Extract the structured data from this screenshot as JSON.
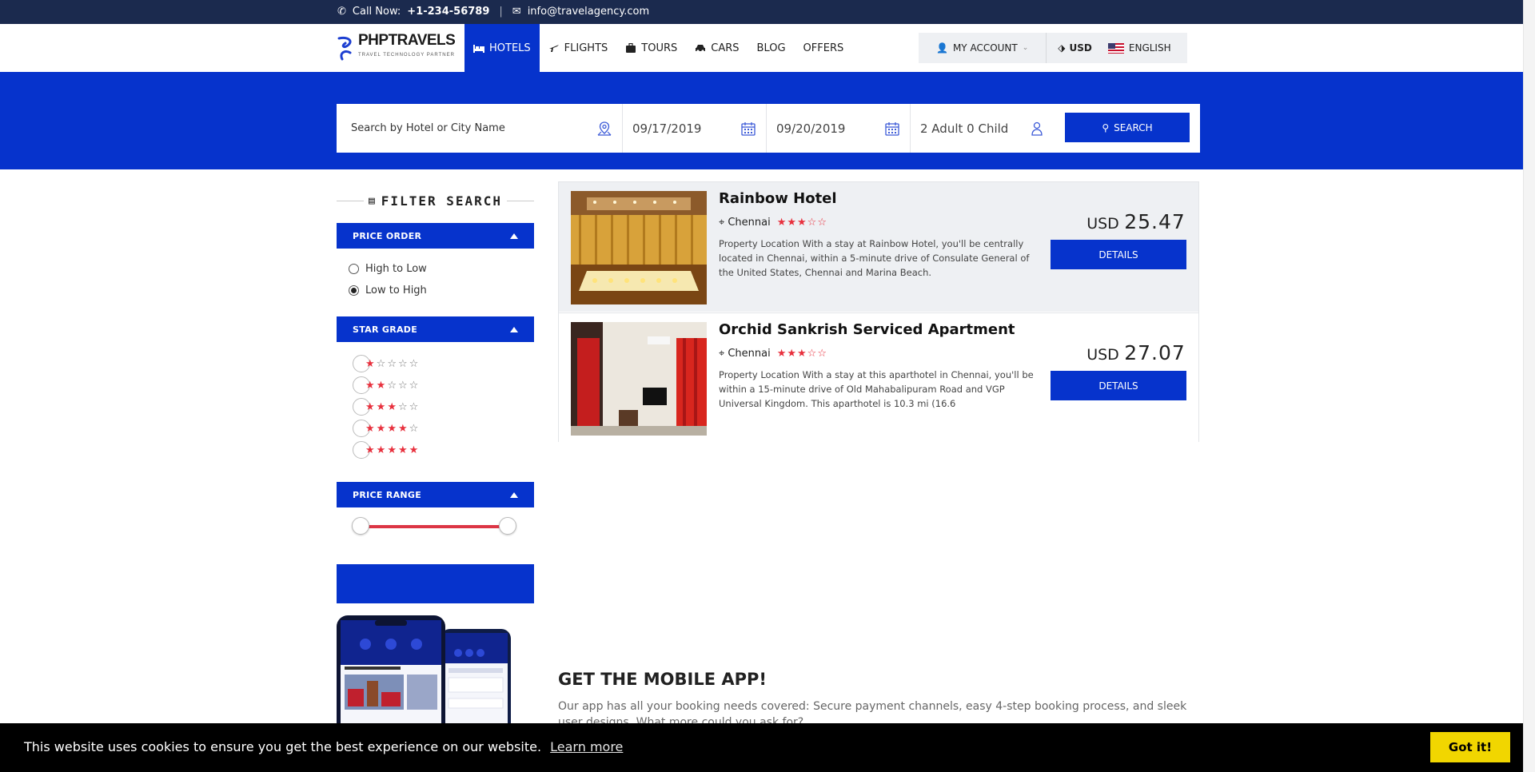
{
  "topbar": {
    "call_label": "Call Now:",
    "phone": "+1-234-56789",
    "email": "info@travelagency.com"
  },
  "header": {
    "logo_text": "PHPTRAVELS",
    "logo_tagline": "TRAVEL TECHNOLOGY PARTNER",
    "nav": {
      "hotels": "HOTELS",
      "flights": "FLIGHTS",
      "tours": "TOURS",
      "cars": "CARS",
      "blog": "BLOG",
      "offers": "OFFERS"
    },
    "account_label": "MY ACCOUNT",
    "currency": "USD",
    "language": "ENGLISH"
  },
  "search": {
    "destination_placeholder": "Search by Hotel or City Name",
    "checkin": "09/17/2019",
    "checkout": "09/20/2019",
    "guests": "2 Adult 0 Child",
    "button": "SEARCH"
  },
  "sidebar": {
    "filter_title": "FILTER SEARCH",
    "price_order": {
      "title": "PRICE ORDER",
      "options": [
        "High to Low",
        "Low to High"
      ],
      "selected": "Low to High"
    },
    "star_grade": {
      "title": "STAR GRADE",
      "levels": [
        1,
        2,
        3,
        4,
        5
      ]
    },
    "price_range": {
      "title": "PRICE RANGE",
      "min_fraction": 0,
      "max_fraction": 1
    }
  },
  "results": [
    {
      "name": "Rainbow Hotel",
      "city": "Chennai",
      "stars": 3,
      "description": "Property Location With a stay at Rainbow Hotel, you'll be centrally located in Chennai, within a 5-minute drive of Consulate General of the United States, Chennai and Marina Beach.",
      "currency": "USD",
      "price": "25.47",
      "button": "DETAILS"
    },
    {
      "name": "Orchid Sankrish Serviced Apartment",
      "city": "Chennai",
      "stars": 3,
      "description": "Property Location With a stay at this aparthotel in Chennai, you'll be within a 15-minute drive of Old Mahabalipuram Road and VGP Universal Kingdom. This aparthotel is 10.3 mi (16.6",
      "currency": "USD",
      "price": "27.07",
      "button": "DETAILS"
    }
  ],
  "mobile_app": {
    "title": "GET THE MOBILE APP!",
    "text": "Our app has all your booking needs covered: Secure payment channels, easy 4-step booking process, and sleek user designs. What more could you ask for?"
  },
  "cookie": {
    "message": "This website uses cookies to ensure you get the best experience on our website.",
    "link": "Learn more",
    "button": "Got it!"
  },
  "colors": {
    "brand_blue": "#0633cc",
    "topbar": "#1b2a4e",
    "star_red": "#e8303d",
    "cookie_button": "#f1d600"
  }
}
